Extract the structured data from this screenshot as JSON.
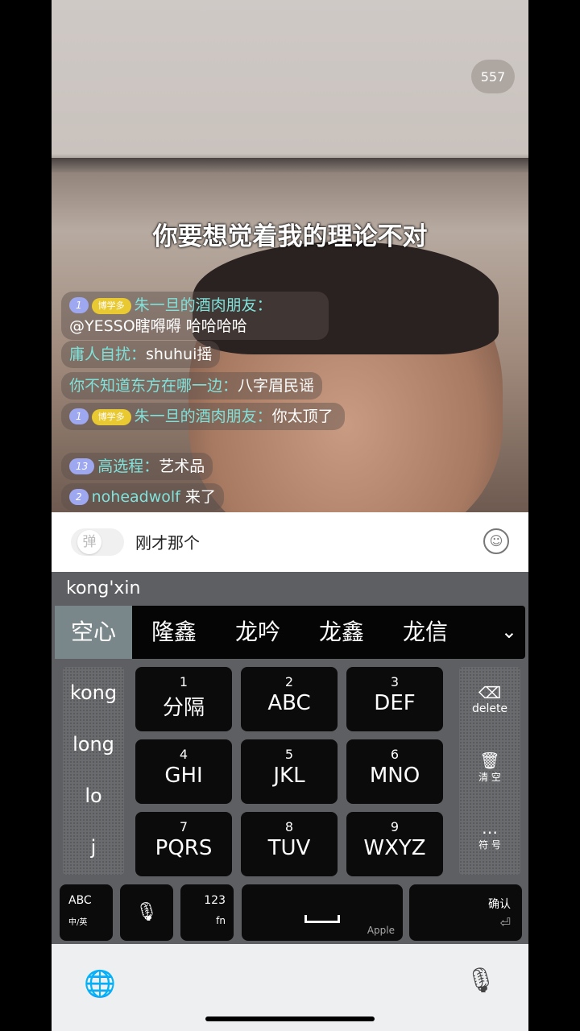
{
  "viewer_count": "557",
  "subtitle": "你要想觉着我的理论不对",
  "chat": [
    {
      "level": "1",
      "fan_badge": "博学多",
      "name": "朱一旦的酒肉朋友：",
      "text": "@YESSO瞎嘚嘚 哈哈哈哈"
    },
    {
      "name": "庸人自扰：",
      "text": "shuhui摇"
    },
    {
      "name": "你不知道东方在哪一边：",
      "text": "八字眉民谣"
    },
    {
      "level": "1",
      "fan_badge": "博学多",
      "name": "朱一旦的酒肉朋友：",
      "text": "你太顶了"
    },
    {
      "level": "13",
      "name": "高选程：",
      "text": "艺术品"
    },
    {
      "level": "2",
      "name": "noheadwolf",
      "text": " 来了"
    }
  ],
  "input": {
    "danmu_toggle": "弹",
    "text": "刚才那个"
  },
  "keyboard": {
    "pinyin": "kong'xin",
    "candidates": [
      "空心",
      "隆鑫",
      "龙吟",
      "龙鑫",
      "龙信"
    ],
    "pinyin_options": [
      "kong",
      "long",
      "lo",
      "j"
    ],
    "keys": [
      {
        "n": "1",
        "l": "分隔"
      },
      {
        "n": "2",
        "l": "ABC"
      },
      {
        "n": "3",
        "l": "DEF"
      },
      {
        "n": "4",
        "l": "GHI"
      },
      {
        "n": "5",
        "l": "JKL"
      },
      {
        "n": "6",
        "l": "MNO"
      },
      {
        "n": "7",
        "l": "PQRS"
      },
      {
        "n": "8",
        "l": "TUV"
      },
      {
        "n": "9",
        "l": "WXYZ"
      }
    ],
    "delete": "delete",
    "clear": "清 空",
    "symbols": "符 号",
    "abc": "ABC",
    "lang": "中/英",
    "num": "123",
    "fn": "fn",
    "space_brand": "Apple",
    "confirm": "确认"
  }
}
